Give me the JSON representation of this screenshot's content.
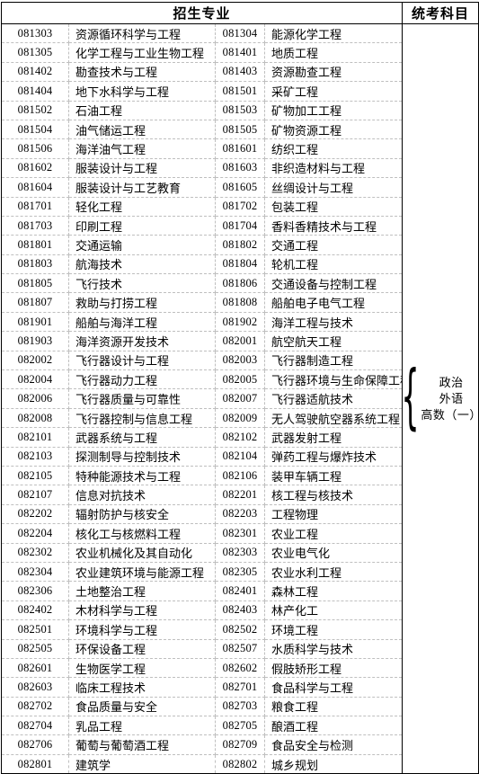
{
  "table": {
    "header": {
      "majors_label": "招生专业",
      "subjects_label": "统考科目"
    },
    "subjects": {
      "brace": "{",
      "items": [
        "政治",
        "外语",
        "高数（一）"
      ]
    },
    "rows": [
      {
        "code_a": "081303",
        "name_a": "资源循环科学与工程",
        "code_b": "081304",
        "name_b": "能源化学工程"
      },
      {
        "code_a": "081305",
        "name_a": "化学工程与工业生物工程",
        "code_b": "081401",
        "name_b": "地质工程"
      },
      {
        "code_a": "081402",
        "name_a": "勘查技术与工程",
        "code_b": "081403",
        "name_b": "资源勘查工程"
      },
      {
        "code_a": "081404",
        "name_a": "地下水科学与工程",
        "code_b": "081501",
        "name_b": "采矿工程"
      },
      {
        "code_a": "081502",
        "name_a": "石油工程",
        "code_b": "081503",
        "name_b": "矿物加工工程"
      },
      {
        "code_a": "081504",
        "name_a": "油气储运工程",
        "code_b": "081505",
        "name_b": "矿物资源工程"
      },
      {
        "code_a": "081506",
        "name_a": "海洋油气工程",
        "code_b": "081601",
        "name_b": "纺织工程"
      },
      {
        "code_a": "081602",
        "name_a": "服装设计与工程",
        "code_b": "081603",
        "name_b": "非织造材料与工程"
      },
      {
        "code_a": "081604",
        "name_a": "服装设计与工艺教育",
        "code_b": "081605",
        "name_b": "丝绸设计与工程"
      },
      {
        "code_a": "081701",
        "name_a": "轻化工程",
        "code_b": "081702",
        "name_b": "包装工程"
      },
      {
        "code_a": "081703",
        "name_a": "印刷工程",
        "code_b": "081704",
        "name_b": "香料香精技术与工程"
      },
      {
        "code_a": "081801",
        "name_a": "交通运输",
        "code_b": "081802",
        "name_b": "交通工程"
      },
      {
        "code_a": "081803",
        "name_a": "航海技术",
        "code_b": "081804",
        "name_b": "轮机工程"
      },
      {
        "code_a": "081805",
        "name_a": "飞行技术",
        "code_b": "081806",
        "name_b": "交通设备与控制工程"
      },
      {
        "code_a": "081807",
        "name_a": "救助与打捞工程",
        "code_b": "081808",
        "name_b": "船舶电子电气工程"
      },
      {
        "code_a": "081901",
        "name_a": "船舶与海洋工程",
        "code_b": "081902",
        "name_b": "海洋工程与技术"
      },
      {
        "code_a": "081903",
        "name_a": "海洋资源开发技术",
        "code_b": "082001",
        "name_b": "航空航天工程"
      },
      {
        "code_a": "082002",
        "name_a": "飞行器设计与工程",
        "code_b": "082003",
        "name_b": "飞行器制造工程"
      },
      {
        "code_a": "082004",
        "name_a": "飞行器动力工程",
        "code_b": "082005",
        "name_b": "飞行器环境与生命保障工程"
      },
      {
        "code_a": "082006",
        "name_a": "飞行器质量与可靠性",
        "code_b": "082007",
        "name_b": "飞行器适航技术"
      },
      {
        "code_a": "082008",
        "name_a": "飞行器控制与信息工程",
        "code_b": "082009",
        "name_b": "无人驾驶航空器系统工程"
      },
      {
        "code_a": "082101",
        "name_a": "武器系统与工程",
        "code_b": "082102",
        "name_b": "武器发射工程"
      },
      {
        "code_a": "082103",
        "name_a": "探测制导与控制技术",
        "code_b": "082104",
        "name_b": "弹药工程与爆炸技术"
      },
      {
        "code_a": "082105",
        "name_a": "特种能源技术与工程",
        "code_b": "082106",
        "name_b": "装甲车辆工程"
      },
      {
        "code_a": "082107",
        "name_a": "信息对抗技术",
        "code_b": "082201",
        "name_b": "核工程与核技术"
      },
      {
        "code_a": "082202",
        "name_a": "辐射防护与核安全",
        "code_b": "082203",
        "name_b": "工程物理"
      },
      {
        "code_a": "082204",
        "name_a": "核化工与核燃料工程",
        "code_b": "082301",
        "name_b": "农业工程"
      },
      {
        "code_a": "082302",
        "name_a": "农业机械化及其自动化",
        "code_b": "082303",
        "name_b": "农业电气化"
      },
      {
        "code_a": "082304",
        "name_a": "农业建筑环境与能源工程",
        "code_b": "082305",
        "name_b": "农业水利工程"
      },
      {
        "code_a": "082306",
        "name_a": "土地整治工程",
        "code_b": "082401",
        "name_b": "森林工程"
      },
      {
        "code_a": "082402",
        "name_a": "木材科学与工程",
        "code_b": "082403",
        "name_b": "林产化工"
      },
      {
        "code_a": "082501",
        "name_a": "环境科学与工程",
        "code_b": "082502",
        "name_b": "环境工程"
      },
      {
        "code_a": "082505",
        "name_a": "环保设备工程",
        "code_b": "082507",
        "name_b": "水质科学与技术"
      },
      {
        "code_a": "082601",
        "name_a": "生物医学工程",
        "code_b": "082602",
        "name_b": "假肢矫形工程"
      },
      {
        "code_a": "082603",
        "name_a": "临床工程技术",
        "code_b": "082701",
        "name_b": "食品科学与工程"
      },
      {
        "code_a": "082702",
        "name_a": "食品质量与安全",
        "code_b": "082703",
        "name_b": "粮食工程"
      },
      {
        "code_a": "082704",
        "name_a": "乳品工程",
        "code_b": "082705",
        "name_b": "酿酒工程"
      },
      {
        "code_a": "082706",
        "name_a": "葡萄与葡萄酒工程",
        "code_b": "082709",
        "name_b": "食品安全与检测"
      },
      {
        "code_a": "082801",
        "name_a": "建筑学",
        "code_b": "082802",
        "name_b": "城乡规划"
      }
    ]
  }
}
